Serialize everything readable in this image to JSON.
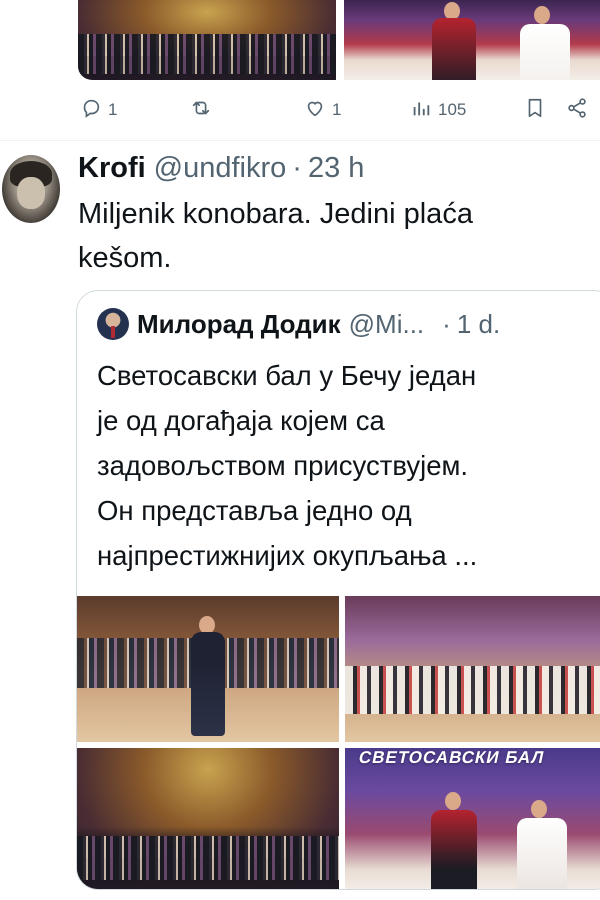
{
  "previous_tweet": {
    "photos": [
      "ballroom-crowd-photo",
      "folk-costume-couple-photo"
    ],
    "actions": {
      "reply_count": "1",
      "retweet_count": "",
      "like_count": "1",
      "view_count": "105"
    }
  },
  "tweet": {
    "display_name": "Krofi",
    "handle": "@undfikro",
    "separator": "·",
    "time": "23 h",
    "text_line1": "Miljenik konobara. Jedini plaća",
    "text_line2": "kešom."
  },
  "quoted_tweet": {
    "display_name": "Милорад Додик",
    "handle": "@Mi...",
    "separator": "·",
    "time": "1 d.",
    "text_lines": [
      "Светосавски бал у Бечу један",
      "је од догађаја којем са",
      "задовољством присуствујем.",
      "Он представља једно од",
      "најпрестижнијих окупљања ..."
    ],
    "banner_text": "СВЕТОСАВСКИ БАЛ"
  },
  "icons": {
    "reply": "reply-icon",
    "retweet": "retweet-icon",
    "like": "heart-icon",
    "views": "views-icon",
    "bookmark": "bookmark-icon",
    "share": "share-icon"
  },
  "colors": {
    "text_primary": "#0f1419",
    "text_secondary": "#536471",
    "border": "#cfd9de"
  }
}
